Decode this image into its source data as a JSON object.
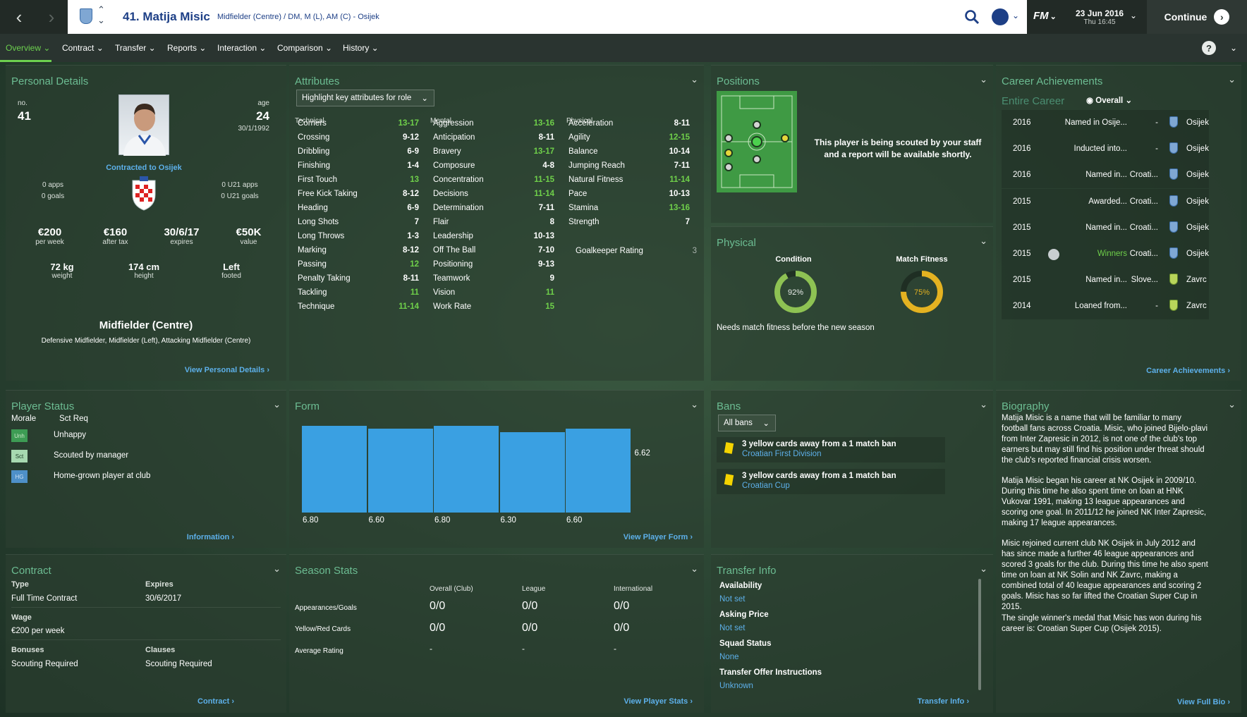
{
  "header": {
    "title": "41. Matija Misic",
    "subtitle": "Midfielder (Centre) / DM, M (L), AM (C) - Osijek",
    "game_logo": "FM",
    "date": "23 Jun 2016",
    "time": "Thu 16:45",
    "continue_label": "Continue"
  },
  "menu": {
    "items": [
      "Overview",
      "Contract",
      "Transfer",
      "Reports",
      "Interaction",
      "Comparison",
      "History"
    ],
    "active": "Overview"
  },
  "personal": {
    "title": "Personal Details",
    "no_label": "no.",
    "no": "41",
    "age_label": "age",
    "age": "24",
    "dob": "30/1/1992",
    "contract_text": "Contracted to Osijek",
    "apps": "0 apps",
    "goals": "0 goals",
    "u21apps": "0 U21 apps",
    "u21goals": "0 U21 goals",
    "wage": "€200",
    "wage_label": "per week",
    "aftertax": "€160",
    "aftertax_label": "after tax",
    "expires": "30/6/17",
    "expires_label": "expires",
    "value": "€50K",
    "value_label": "value",
    "weight": "72 kg",
    "weight_label": "weight",
    "height": "174 cm",
    "height_label": "height",
    "foot": "Left",
    "foot_label": "footed",
    "position": "Midfielder (Centre)",
    "positions": "Defensive Midfielder, Midfielder (Left), Attacking Midfielder (Centre)",
    "link": "View Personal Details"
  },
  "attributes": {
    "title": "Attributes",
    "dropdown": "Highlight key attributes for role",
    "technical_label": "Technical",
    "mental_label": "Mental",
    "physical_label": "Physical",
    "technical": [
      {
        "n": "Corners",
        "v": "13-17",
        "g": true
      },
      {
        "n": "Crossing",
        "v": "9-12",
        "g": false
      },
      {
        "n": "Dribbling",
        "v": "6-9",
        "g": false
      },
      {
        "n": "Finishing",
        "v": "1-4",
        "g": false
      },
      {
        "n": "First Touch",
        "v": "13",
        "g": true
      },
      {
        "n": "Free Kick Taking",
        "v": "8-12",
        "g": false
      },
      {
        "n": "Heading",
        "v": "6-9",
        "g": false
      },
      {
        "n": "Long Shots",
        "v": "7",
        "g": false
      },
      {
        "n": "Long Throws",
        "v": "1-3",
        "g": false
      },
      {
        "n": "Marking",
        "v": "8-12",
        "g": false
      },
      {
        "n": "Passing",
        "v": "12",
        "g": true
      },
      {
        "n": "Penalty Taking",
        "v": "8-11",
        "g": false
      },
      {
        "n": "Tackling",
        "v": "11",
        "g": true
      },
      {
        "n": "Technique",
        "v": "11-14",
        "g": true
      }
    ],
    "mental": [
      {
        "n": "Aggression",
        "v": "13-16",
        "g": true
      },
      {
        "n": "Anticipation",
        "v": "8-11",
        "g": false
      },
      {
        "n": "Bravery",
        "v": "13-17",
        "g": true
      },
      {
        "n": "Composure",
        "v": "4-8",
        "g": false
      },
      {
        "n": "Concentration",
        "v": "11-15",
        "g": true
      },
      {
        "n": "Decisions",
        "v": "11-14",
        "g": true
      },
      {
        "n": "Determination",
        "v": "7-11",
        "g": false
      },
      {
        "n": "Flair",
        "v": "8",
        "g": false
      },
      {
        "n": "Leadership",
        "v": "10-13",
        "g": false
      },
      {
        "n": "Off The Ball",
        "v": "7-10",
        "g": false
      },
      {
        "n": "Positioning",
        "v": "9-13",
        "g": false
      },
      {
        "n": "Teamwork",
        "v": "9",
        "g": false
      },
      {
        "n": "Vision",
        "v": "11",
        "g": true
      },
      {
        "n": "Work Rate",
        "v": "15",
        "g": true
      }
    ],
    "physical": [
      {
        "n": "Acceleration",
        "v": "8-11",
        "g": false
      },
      {
        "n": "Agility",
        "v": "12-15",
        "g": true
      },
      {
        "n": "Balance",
        "v": "10-14",
        "g": false
      },
      {
        "n": "Jumping Reach",
        "v": "7-11",
        "g": false
      },
      {
        "n": "Natural Fitness",
        "v": "11-14",
        "g": true
      },
      {
        "n": "Pace",
        "v": "10-13",
        "g": false
      },
      {
        "n": "Stamina",
        "v": "13-16",
        "g": true
      },
      {
        "n": "Strength",
        "v": "7",
        "g": false
      }
    ],
    "goalkeeper": {
      "n": "Goalkeeper Rating",
      "v": "3"
    }
  },
  "positions": {
    "title": "Positions",
    "scouting_note": "This player is being scouted by your staff and a report will be available shortly."
  },
  "physical": {
    "title": "Physical",
    "condition_label": "Condition",
    "condition": 92,
    "condition_text": "92%",
    "fitness_label": "Match Fitness",
    "fitness": 75,
    "fitness_text": "75%",
    "note": "Needs match fitness before the new season"
  },
  "career": {
    "title": "Career Achievements",
    "subtitle": "Entire Career",
    "filter": "Overall",
    "link": "Career Achievements",
    "rows": [
      {
        "year": "2016",
        "desc": "Named in Osije...",
        "region": "-",
        "club": "Osijek"
      },
      {
        "year": "2016",
        "desc": "Inducted into...",
        "region": "-",
        "club": "Osijek"
      },
      {
        "year": "2016",
        "desc": "Named in...",
        "region": "Croati...",
        "club": "Osijek"
      },
      {
        "year": "2015",
        "desc": "Awarded...",
        "region": "Croati...",
        "club": "Osijek"
      },
      {
        "year": "2015",
        "desc": "Named in...",
        "region": "Croati...",
        "club": "Osijek"
      },
      {
        "year": "2015",
        "desc": "Winners",
        "region": "Croati...",
        "club": "Osijek"
      },
      {
        "year": "2015",
        "desc": "Named in...",
        "region": "Slove...",
        "club": "Zavrc"
      },
      {
        "year": "2014",
        "desc": "Loaned from...",
        "region": "-",
        "club": "Zavrc"
      }
    ]
  },
  "status": {
    "title": "Player Status",
    "morale_label": "Morale",
    "morale_value": "Sct Req",
    "items": [
      {
        "icon": "Unh",
        "text": "Unhappy"
      },
      {
        "icon": "Sct",
        "text": "Scouted by manager"
      },
      {
        "icon": "HG",
        "text": "Home-grown player at club"
      }
    ],
    "link": "Information"
  },
  "form": {
    "title": "Form",
    "link": "View Player Form"
  },
  "chart_data": {
    "type": "bar",
    "categories": [
      "",
      "",
      "",
      "",
      ""
    ],
    "values": [
      6.8,
      6.6,
      6.8,
      6.3,
      6.6
    ],
    "value_labels": [
      "6.80",
      "6.60",
      "6.80",
      "6.30",
      "6.60"
    ],
    "average": 6.62,
    "average_label": "6.62",
    "ylim": [
      0,
      7.2
    ]
  },
  "bans": {
    "title": "Bans",
    "filter": "All bans",
    "items": [
      {
        "text": "3 yellow cards away from a 1 match ban",
        "comp": "Croatian First Division"
      },
      {
        "text": "3 yellow cards away from a 1 match ban",
        "comp": "Croatian Cup"
      }
    ]
  },
  "biography": {
    "title": "Biography",
    "paragraphs": [
      "Matija Misic is a name that will be familiar to many football fans across Croatia. Misic, who joined Bijelo-plavi from Inter Zapresic in 2012, is not one of the club's top earners but may still find his position under threat should the club's reported financial crisis worsen.",
      "Matija Misic began his career at NK Osijek in 2009/10. During this time he also spent time on loan at HNK Vukovar 1991, making 13 league appearances and scoring one goal. In 2011/12 he joined NK Inter Zapresic, making 17 league appearances.",
      "Misic rejoined current club NK Osijek in July 2012 and has since made a further 46 league appearances and scored 3 goals for the club. During this time he also spent time on loan at NK Solin and NK Zavrc, making a combined total of 40 league appearances and scoring 2 goals. Misic has so far lifted the Croatian Super Cup in 2015.",
      "The single winner's medal that Misic has won during his career is: Croatian Super Cup (Osijek 2015)."
    ],
    "link": "View Full Bio"
  },
  "contract": {
    "title": "Contract",
    "type_label": "Type",
    "type": "Full Time Contract",
    "expires_label": "Expires",
    "expires": "30/6/2017",
    "wage_label": "Wage",
    "wage": "€200 per week",
    "bonuses_label": "Bonuses",
    "bonuses": "Scouting Required",
    "clauses_label": "Clauses",
    "clauses": "Scouting Required",
    "link": "Contract"
  },
  "season": {
    "title": "Season Stats",
    "cols": [
      "Overall (Club)",
      "League",
      "International"
    ],
    "rows": [
      {
        "label": "Appearances/Goals",
        "vals": [
          "0/0",
          "0/0",
          "0/0"
        ]
      },
      {
        "label": "Yellow/Red Cards",
        "vals": [
          "0/0",
          "0/0",
          "0/0"
        ]
      },
      {
        "label": "Average Rating",
        "vals": [
          "-",
          "-",
          "-"
        ]
      }
    ],
    "link": "View Player Stats"
  },
  "transfer": {
    "title": "Transfer Info",
    "items": [
      {
        "label": "Availability",
        "value": "Not set"
      },
      {
        "label": "Asking Price",
        "value": "Not set"
      },
      {
        "label": "Squad Status",
        "value": "None"
      },
      {
        "label": "Transfer Offer Instructions",
        "value": "Unknown"
      }
    ],
    "link": "Transfer Info"
  }
}
